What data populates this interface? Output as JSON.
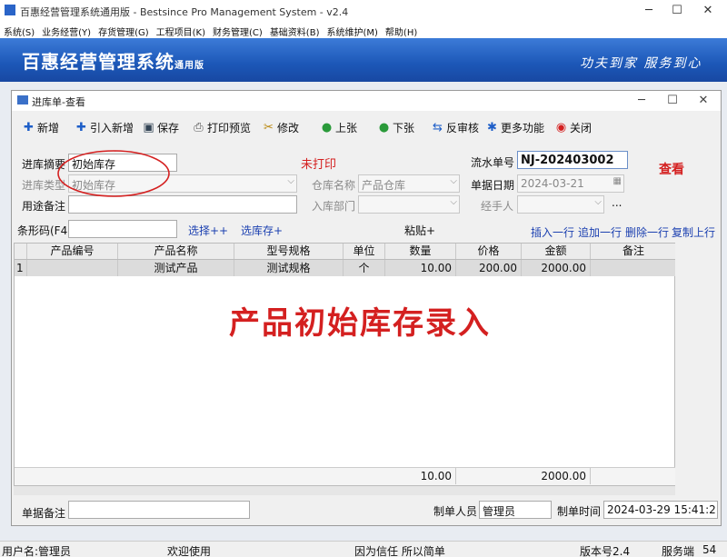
{
  "app": {
    "window_title": "百惠经营管理系统通用版 - Bestsince Pro Management System - v2.4",
    "menu": [
      "系统(S)",
      "业务经营(Y)",
      "存货管理(G)",
      "工程项目(K)",
      "财务管理(C)",
      "基础资料(B)",
      "系统维护(M)",
      "帮助(H)"
    ],
    "banner_name": "百惠经营管理系统",
    "banner_edition": "通用版",
    "slogan": "功夫到家  服务到心"
  },
  "form": {
    "title": "进库单-查看",
    "toolbar": [
      "新增",
      "引入新增",
      "保存",
      "打印预览",
      "修改",
      "上张",
      "下张",
      "反审核",
      "更多功能",
      "关闭"
    ],
    "summary_label": "进库摘要",
    "summary_value": "初始库存",
    "type_label": "进库类型",
    "type_value": "初始库存",
    "purpose_label": "用途备注",
    "print_status": "未打印",
    "warehouse_label": "仓库名称",
    "warehouse_value": "产品仓库",
    "dept_label": "入库部门",
    "serial_label": "流水单号",
    "serial_value": "NJ-202403002",
    "view_mode": "查看",
    "date_label": "单据日期",
    "date_value": "2024-03-21",
    "handler_label": "经手人",
    "ellipsis": "...",
    "barcode_label": "条形码(F4)",
    "select_label": "选择++",
    "select_stock_label": "选库存+",
    "paste_label": "粘贴+",
    "row_actions": [
      "插入一行",
      "追加一行",
      "删除一行",
      "复制上行"
    ],
    "headers": [
      "产品编号",
      "产品名称",
      "型号规格",
      "单位",
      "数量",
      "价格",
      "金额",
      "备注"
    ],
    "rows": [
      {
        "no": "1",
        "code": "",
        "name": "测试产品",
        "spec": "测试规格",
        "unit": "个",
        "qty": "10.00",
        "price": "200.00",
        "amount": "2000.00",
        "note": ""
      }
    ],
    "totals": {
      "qty": "10.00",
      "amount": "2000.00"
    },
    "overlay_caption": "产品初始库存录入",
    "remark_label": "单据备注",
    "maker_label": "制单人员",
    "maker_value": "管理员",
    "made_time_label": "制单时间",
    "made_time_value": "2024-03-29 15:41:21"
  },
  "statusbar": {
    "user": "用户名:管理员",
    "welcome": "欢迎使用",
    "motto": "因为信任 所以简单",
    "version": "版本号2.4",
    "server": "服务端",
    "server_num": "54"
  },
  "colors": {
    "banner": "#1c57b7",
    "accent_red": "#d42020",
    "link_blue": "#1a3fb0"
  }
}
